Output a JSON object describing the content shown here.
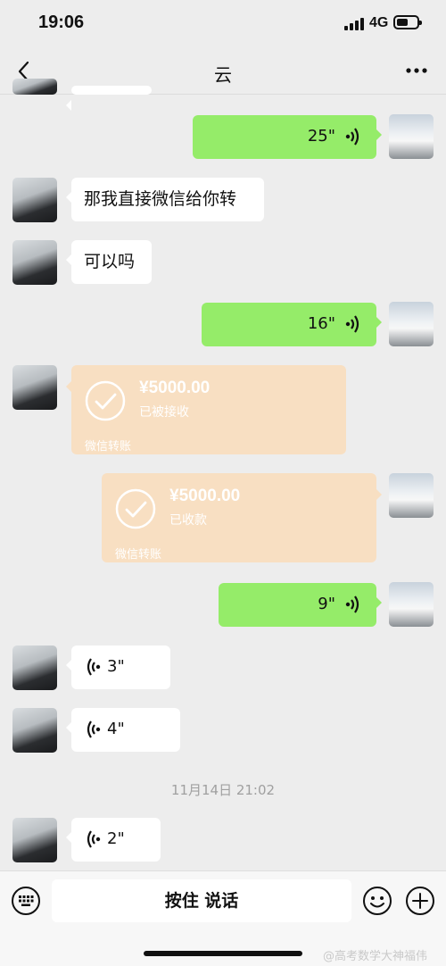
{
  "status_bar": {
    "time": "19:06",
    "network": "4G"
  },
  "nav": {
    "title": "云"
  },
  "messages": {
    "m1": {
      "duration": "25\""
    },
    "m2": {
      "text": "那我直接微信给你转"
    },
    "m3": {
      "text": "可以吗"
    },
    "m4": {
      "duration": "16\""
    },
    "m5": {
      "amount": "¥5000.00",
      "status": "已被接收",
      "brand": "微信转账"
    },
    "m6": {
      "amount": "¥5000.00",
      "status": "已收款",
      "brand": "微信转账"
    },
    "m7": {
      "duration": "9\""
    },
    "m8": {
      "duration": "3\""
    },
    "m9": {
      "duration": "4\""
    },
    "timestamp": "11月14日 21:02",
    "m10": {
      "duration": "2\""
    }
  },
  "input_bar": {
    "hold_to_talk": "按住 说话"
  },
  "watermark": "@高考数学大神福伟",
  "colors": {
    "background": "#ededed",
    "green_bubble": "#95ec69",
    "transfer_card": "#f8dfc2"
  },
  "icons": [
    "back-arrow-icon",
    "more-icon",
    "voice-wave-icon",
    "check-circle-icon",
    "keyboard-icon",
    "emoji-icon",
    "plus-icon"
  ]
}
